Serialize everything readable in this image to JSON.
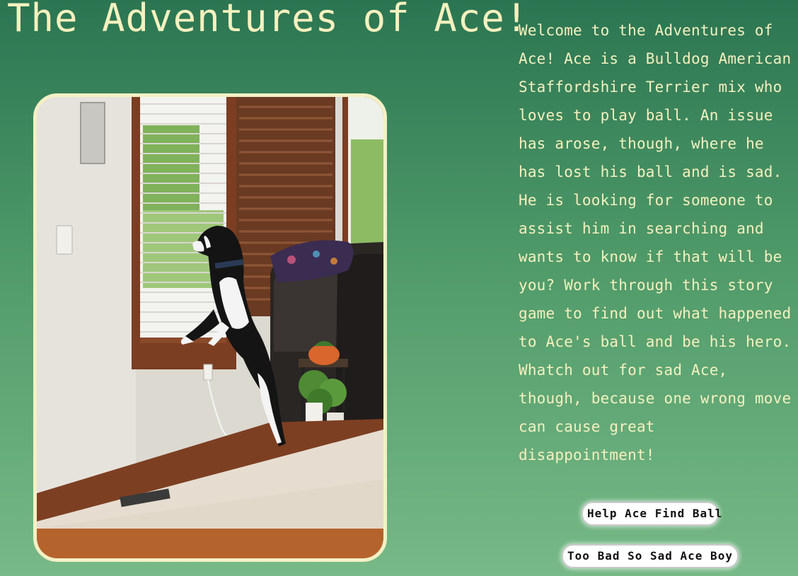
{
  "page": {
    "title": "The Adventures of Ace!"
  },
  "photo": {
    "alt": "Ace, a black and white dog, standing on his hind legs looking out a window"
  },
  "intro": {
    "text": "Welcome to the Adventures of Ace! Ace is a Bulldog American Staffordshire Terrier mix who loves to play ball. An issue has arose, though, where he has lost his ball and is sad. He is looking for someone to assist him in searching and wants to know if that will be you? Work through this story game to find out what happened to Ace's ball and be his hero. Whatch out for sad Ace, though, because one wrong move can cause great disappointment!"
  },
  "buttons": {
    "help_label": "Help Ace Find Ball",
    "sad_label": "Too Bad So Sad Ace Boy"
  },
  "colors": {
    "background_top": "#2b7552",
    "background_bottom": "#77b987",
    "text_cream": "#f5f1bf",
    "frame_border": "#f4f0c4"
  }
}
